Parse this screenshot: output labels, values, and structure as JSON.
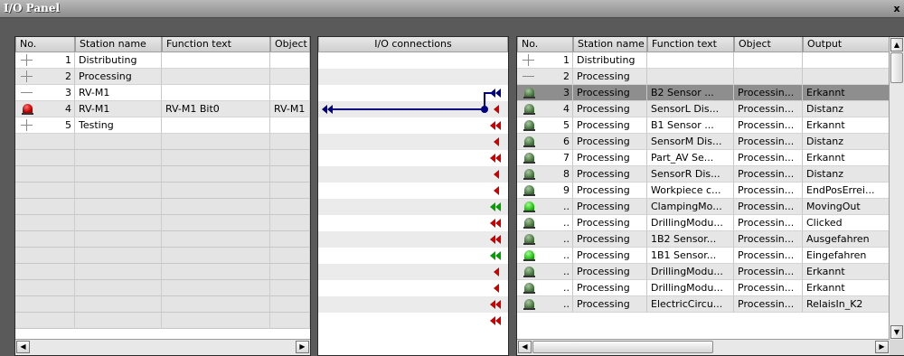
{
  "window": {
    "title": "I/O Panel",
    "close_glyph": "x"
  },
  "left": {
    "headers": [
      "No.",
      "Station name",
      "Function text",
      "Object"
    ],
    "rows": [
      {
        "icon": "plus",
        "no": "1",
        "station": "Distributing",
        "func": "",
        "obj": ""
      },
      {
        "icon": "plus",
        "no": "2",
        "station": "Processing",
        "func": "",
        "obj": ""
      },
      {
        "icon": "minus",
        "no": "3",
        "station": "RV-M1",
        "func": "",
        "obj": ""
      },
      {
        "icon": "red-bell",
        "no": "4",
        "station": "RV-M1",
        "func": "RV-M1 Bit0",
        "obj": "RV-M1"
      },
      {
        "icon": "plus",
        "no": "5",
        "station": "Testing",
        "func": "",
        "obj": ""
      }
    ],
    "empty_rows": 12
  },
  "middle": {
    "header": "I/O connections",
    "connector_colors": [
      "#000080",
      "#cc0000",
      "#00a000"
    ],
    "right_arrows": [
      "",
      "",
      "double-blue",
      "single-red",
      "double-red",
      "single-red",
      "double-red",
      "single-red",
      "single-red",
      "double-green",
      "double-red",
      "double-red",
      "double-green",
      "single-red",
      "single-red",
      "double-red",
      "double-red"
    ]
  },
  "right": {
    "headers": [
      "No.",
      "Station name",
      "Function text",
      "Object",
      "Output"
    ],
    "rows": [
      {
        "icon": "plus",
        "no": "1",
        "station": "Distributing",
        "func": "",
        "obj": "",
        "out": ""
      },
      {
        "icon": "minus",
        "no": "2",
        "station": "Processing",
        "func": "",
        "obj": "",
        "out": ""
      },
      {
        "icon": "bell-dark",
        "no": "3",
        "station": "Processing",
        "func": "B2 Sensor ...",
        "obj": "Processin...",
        "out": "Erkannt",
        "selected": true
      },
      {
        "icon": "bell-dark",
        "no": "4",
        "station": "Processing",
        "func": "SensorL Dis...",
        "obj": "Processin...",
        "out": "Distanz"
      },
      {
        "icon": "bell-dark",
        "no": "5",
        "station": "Processing",
        "func": "B1 Sensor ...",
        "obj": "Processin...",
        "out": "Erkannt"
      },
      {
        "icon": "bell-dark",
        "no": "6",
        "station": "Processing",
        "func": "SensorM Dis...",
        "obj": "Processin...",
        "out": "Distanz"
      },
      {
        "icon": "bell-dark",
        "no": "7",
        "station": "Processing",
        "func": "Part_AV Se...",
        "obj": "Processin...",
        "out": "Erkannt"
      },
      {
        "icon": "bell-dark",
        "no": "8",
        "station": "Processing",
        "func": "SensorR Dis...",
        "obj": "Processin...",
        "out": "Distanz"
      },
      {
        "icon": "bell-dark",
        "no": "9",
        "station": "Processing",
        "func": "Workpiece c...",
        "obj": "Processin...",
        "out": "EndPosErrei..."
      },
      {
        "icon": "bell-bright",
        "no": "..",
        "station": "Processing",
        "func": "ClampingMo...",
        "obj": "Processin...",
        "out": "MovingOut"
      },
      {
        "icon": "bell-dark",
        "no": "..",
        "station": "Processing",
        "func": "DrillingModu...",
        "obj": "Processin...",
        "out": "Clicked"
      },
      {
        "icon": "bell-dark",
        "no": "..",
        "station": "Processing",
        "func": "1B2 Sensor...",
        "obj": "Processin...",
        "out": "Ausgefahren"
      },
      {
        "icon": "bell-bright",
        "no": "..",
        "station": "Processing",
        "func": "1B1 Sensor...",
        "obj": "Processin...",
        "out": "Eingefahren"
      },
      {
        "icon": "bell-dark",
        "no": "..",
        "station": "Processing",
        "func": "DrillingModu...",
        "obj": "Processin...",
        "out": "Erkannt"
      },
      {
        "icon": "bell-dark",
        "no": "..",
        "station": "Processing",
        "func": "DrillingModu...",
        "obj": "Processin...",
        "out": "Erkannt"
      },
      {
        "icon": "bell-dark",
        "no": "..",
        "station": "Processing",
        "func": "ElectricCircu...",
        "obj": "Processin...",
        "out": "RelaisIn_K2"
      }
    ]
  },
  "scroll": {
    "left_glyph": "◀",
    "right_glyph": "▶",
    "up_glyph": "▲",
    "down_glyph": "▼"
  }
}
